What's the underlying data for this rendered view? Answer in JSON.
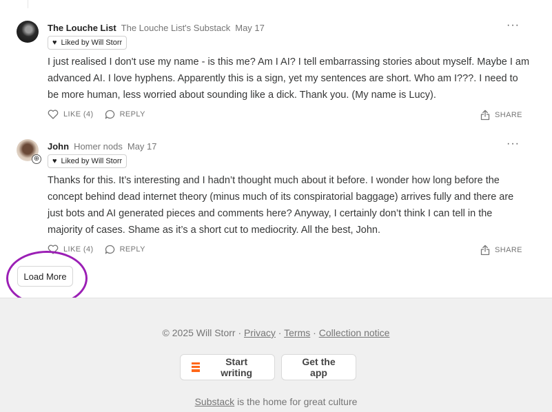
{
  "comments": [
    {
      "author": "The Louche List",
      "publication": "The Louche List's Substack",
      "date": "May 17",
      "liked_by": "Liked by Will Storr",
      "body": "I just realised I don't use my name - is this me? Am I AI? I tell embarrassing stories about myself. Maybe I am advanced AI. I love hyphens. Apparently this is a sign, yet my sentences are short. Who am I???. I need to be more human, less worried about sounding like a dick. Thank you. (My name is Lucy).",
      "like_label": "LIKE (4)",
      "reply_label": "REPLY",
      "share_label": "SHARE",
      "more_label": "···"
    },
    {
      "author": "John",
      "publication": "Homer nods",
      "date": "May 17",
      "liked_by": "Liked by Will Storr",
      "body": "Thanks for this. It’s interesting and I hadn’t thought much about it before. I wonder how long before the concept behind dead internet theory (minus much of its conspiratorial baggage) arrives fully and there are just bots and AI generated pieces and comments here? Anyway, I certainly don’t think I can tell in the majority of cases. Shame as it’s a short cut to mediocrity. All the best, John.",
      "like_label": "LIKE (4)",
      "reply_label": "REPLY",
      "share_label": "SHARE",
      "more_label": "···"
    }
  ],
  "load_more_label": "Load More",
  "footer": {
    "copyright": "© 2025 Will Storr",
    "sep": " · ",
    "privacy": "Privacy",
    "terms": "Terms",
    "collection_notice": "Collection notice",
    "start_writing": "Start writing",
    "get_app": "Get the app",
    "substack": "Substack",
    "tagline_rest": " is the home for great culture"
  },
  "colors": {
    "accent": "#ff6719",
    "annotation_circle": "#9b1fb5"
  }
}
